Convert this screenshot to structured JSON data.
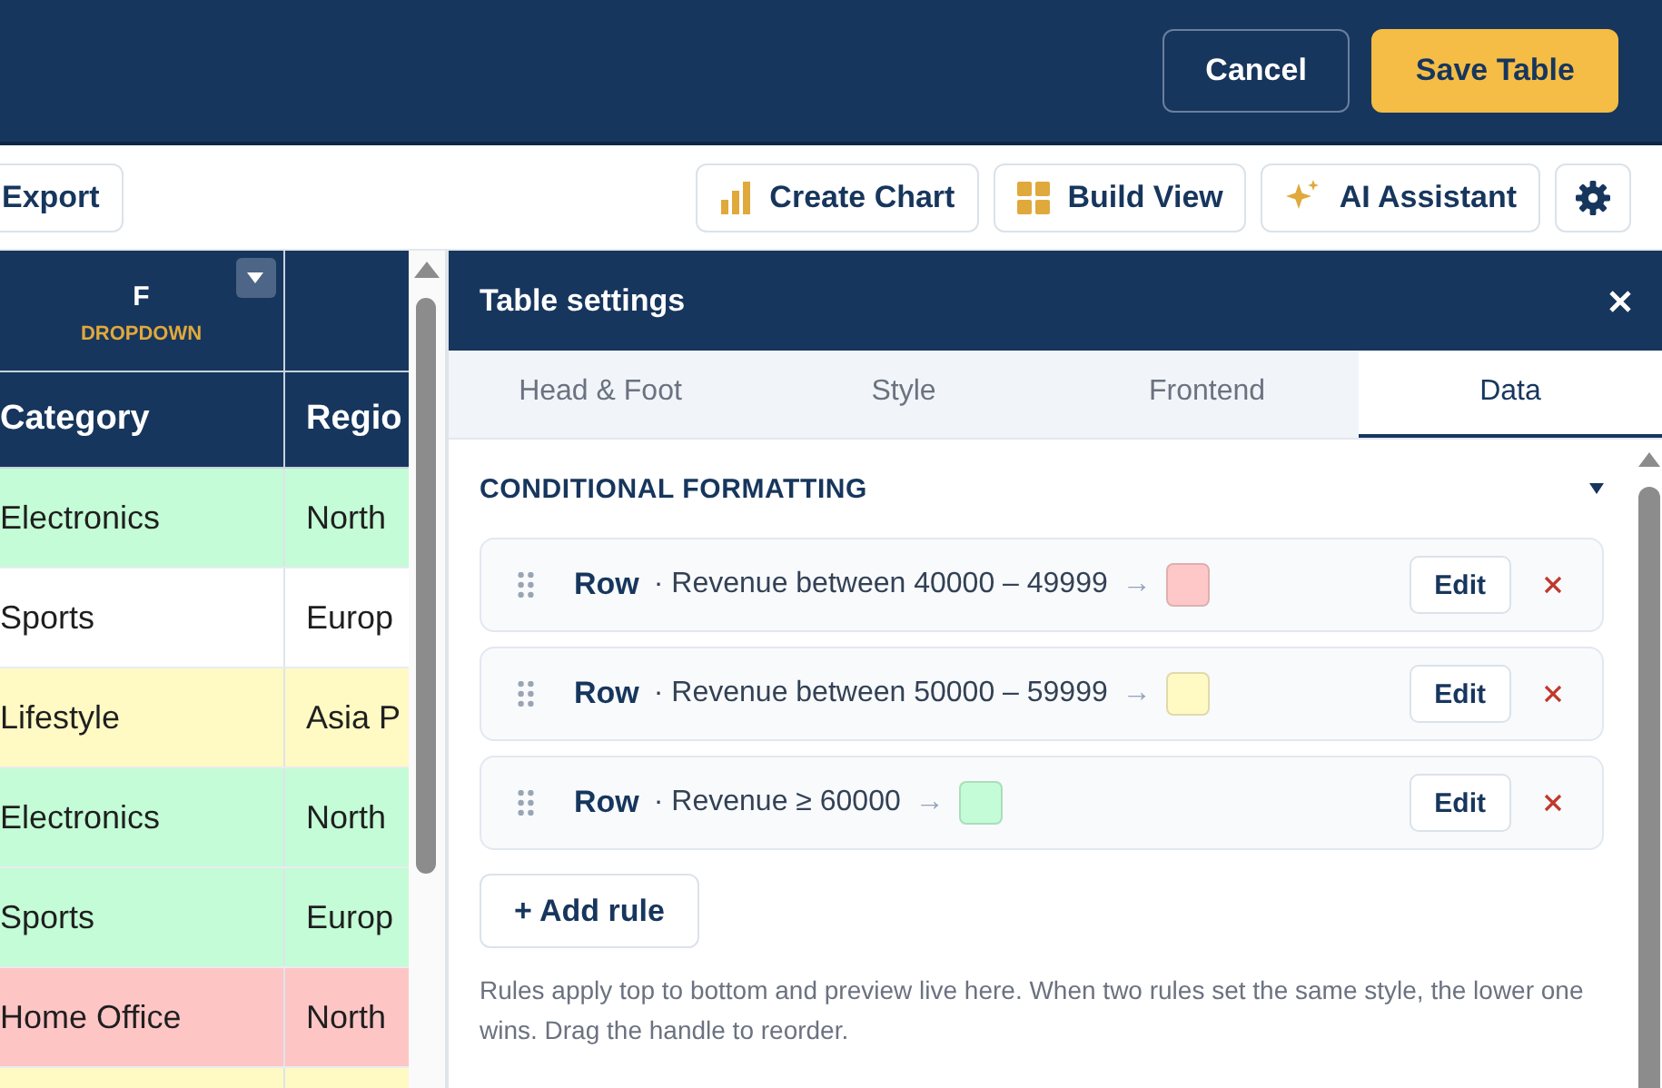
{
  "topbar": {
    "buttons": [
      {
        "label": "Cancel",
        "kind": "secondary"
      },
      {
        "label": "Save Table",
        "kind": "primary"
      }
    ]
  },
  "toolbar": {
    "export": "Export",
    "actions": [
      {
        "label": "Create Chart"
      },
      {
        "label": "Build View"
      },
      {
        "label": "AI Assistant"
      }
    ]
  },
  "table": {
    "column_header": {
      "letter": "F",
      "type": "DROPDOWN"
    },
    "columns": [
      "Category",
      "Regio"
    ],
    "rows": [
      {
        "color": "#c3fcd6",
        "cells": [
          "Electronics",
          "North"
        ]
      },
      {
        "color": "#ffffff",
        "cells": [
          "Sports",
          "Europ"
        ]
      },
      {
        "color": "#fff9c4",
        "cells": [
          "Lifestyle",
          "Asia P"
        ]
      },
      {
        "color": "#c3fcd6",
        "cells": [
          "Electronics",
          "North"
        ]
      },
      {
        "color": "#c3fcd6",
        "cells": [
          "Sports",
          "Europ"
        ]
      },
      {
        "color": "#fec5c5",
        "cells": [
          "Home Office",
          "North"
        ]
      },
      {
        "color": "#fff9c4",
        "cells": []
      }
    ]
  },
  "panel": {
    "title": "Table settings",
    "tabs": [
      {
        "label": "Head & Foot",
        "selected": false
      },
      {
        "label": "Style",
        "selected": false
      },
      {
        "label": "Frontend",
        "selected": false
      },
      {
        "label": "Data",
        "selected": true
      }
    ],
    "section": {
      "title": "CONDITIONAL FORMATTING",
      "expanded": true
    },
    "rules": [
      {
        "scope": "Row",
        "condition": "· Revenue between 40000 – 49999",
        "arrow": "→",
        "color": "#fec8c8",
        "edit": "Edit"
      },
      {
        "scope": "Row",
        "condition": "· Revenue between 50000 – 59999",
        "arrow": "→",
        "color": "#fff9c4",
        "edit": "Edit"
      },
      {
        "scope": "Row",
        "condition": "· Revenue ≥ 60000",
        "arrow": "→",
        "color": "#c3fcd6",
        "edit": "Edit"
      }
    ],
    "add_rule": "+ Add rule",
    "note": "Rules apply top to bottom and preview live here. When two rules set the same style, the lower one wins. Drag the handle to reorder."
  }
}
